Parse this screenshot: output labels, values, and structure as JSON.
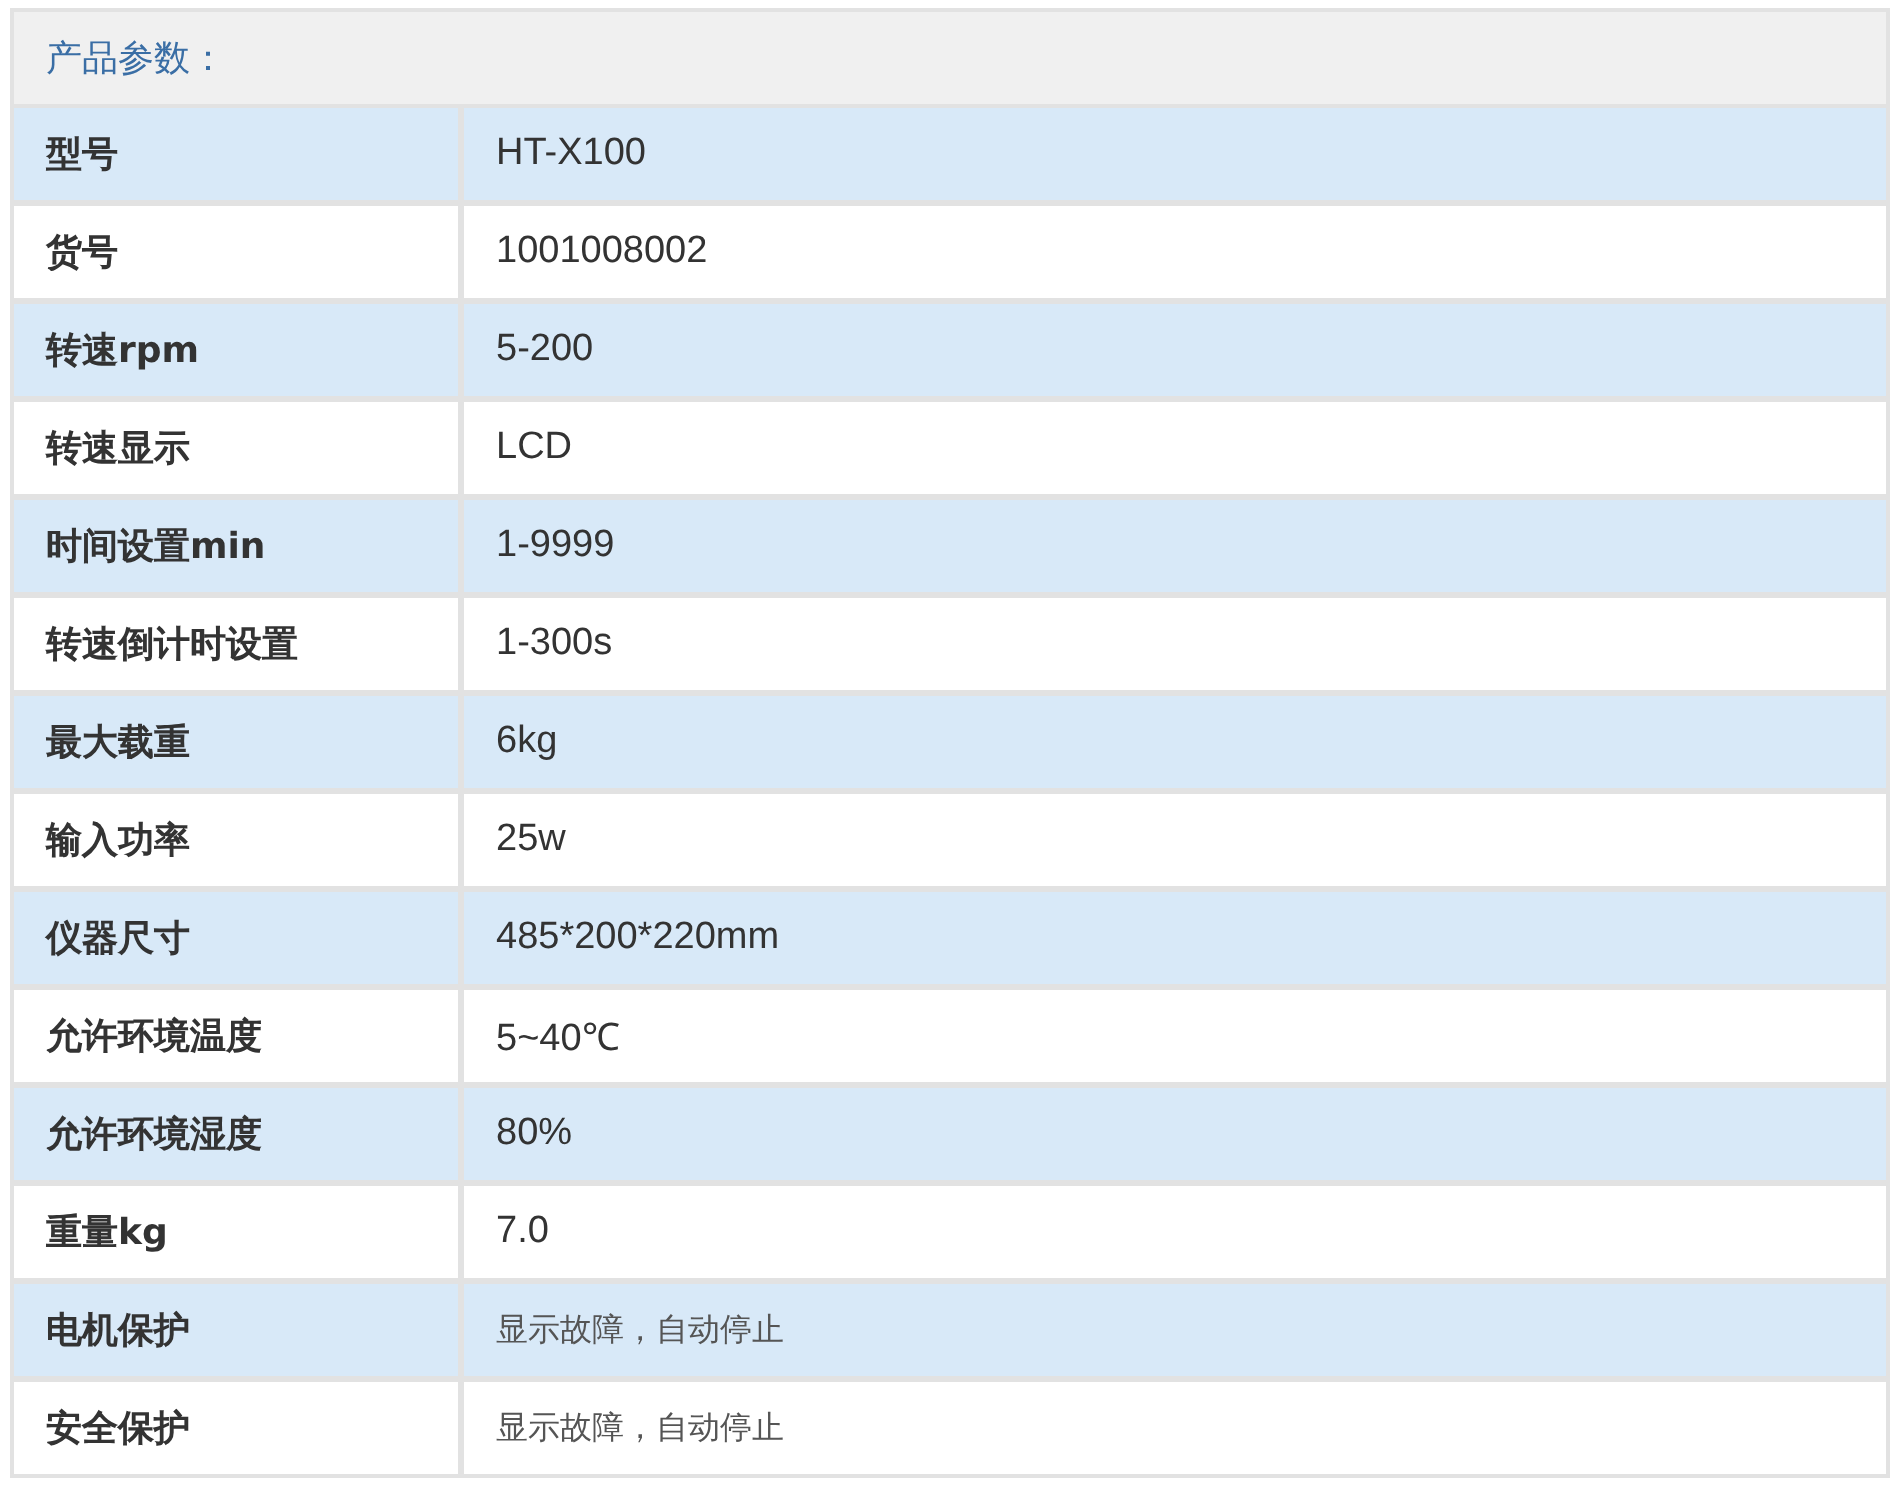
{
  "title": "产品参数：",
  "rows": [
    {
      "label": "型号",
      "value": "HT-X100",
      "kind": "plain"
    },
    {
      "label": "货号",
      "value": "1001008002",
      "kind": "plain"
    },
    {
      "label": "转速rpm",
      "value": "5-200",
      "kind": "plain"
    },
    {
      "label": "转速显示",
      "value": "LCD",
      "kind": "plain"
    },
    {
      "label": "时间设置min",
      "value": "1-9999",
      "kind": "plain"
    },
    {
      "label": "转速倒计时设置",
      "value": "1-300s",
      "kind": "plain"
    },
    {
      "label": "最大载重",
      "value": "6kg",
      "kind": "plain"
    },
    {
      "label": "输入功率",
      "value": "25w",
      "kind": "plain"
    },
    {
      "label": "仪器尺寸",
      "value": "485*200*220mm",
      "kind": "plain"
    },
    {
      "label": "允许环境温度",
      "value": "5~40℃",
      "kind": "plain"
    },
    {
      "label": "允许环境湿度",
      "value": "80%",
      "kind": "plain"
    },
    {
      "label": "重量kg",
      "value": "7.0",
      "kind": "plain"
    },
    {
      "label": "电机保护",
      "value": "显示故障，自动停止",
      "kind": "note"
    },
    {
      "label": "安全保护",
      "value": "显示故障，自动停止",
      "kind": "note"
    }
  ]
}
